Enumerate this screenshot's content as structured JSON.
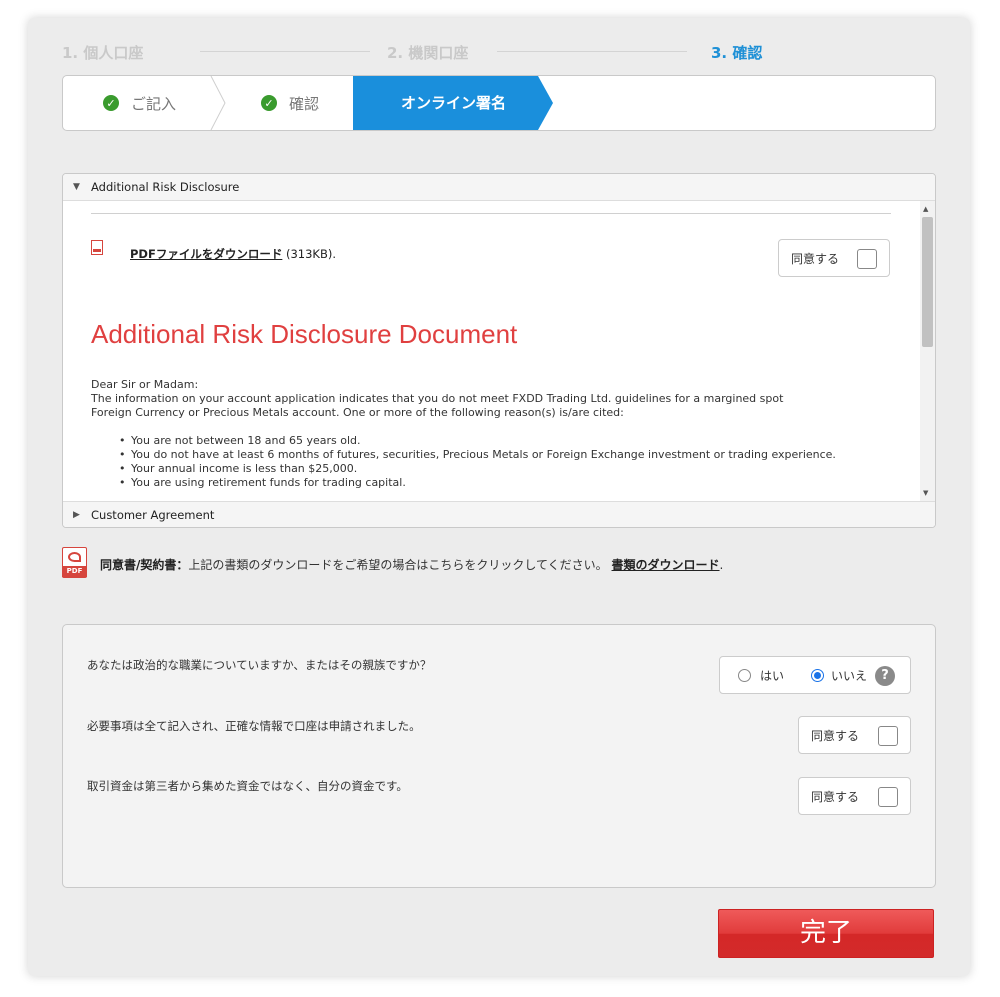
{
  "steps": {
    "step1": "1. 個人口座",
    "step2": "2. 機関口座",
    "step3": "3. 確認"
  },
  "substeps": {
    "fill": "ご記入",
    "confirm": "確認",
    "sign": "オンライン署名"
  },
  "accordion": {
    "section1_title": "Additional Risk Disclosure",
    "section2_title": "Customer Agreement",
    "download_link": "PDFファイルをダウンロード",
    "download_size": "(313KB).",
    "agree_label": "同意する",
    "doc_title": "Additional Risk Disclosure Document",
    "salutation": "Dear Sir or Madam:",
    "para1": "The information on your account application indicates that you do not meet FXDD Trading Ltd. guidelines for a margined spot",
    "para2": "Foreign Currency or Precious Metals account. One or more of the following reason(s) is/are cited:",
    "bullets": [
      "You are not between 18 and 65 years old.",
      "You do not have at least 6 months of futures, securities, Precious Metals or Foreign Exchange investment or trading experience.",
      "Your annual income is less than $25,000.",
      "You are using retirement funds for trading capital."
    ]
  },
  "download_all": {
    "label": "同意書/契約書：",
    "text": "上記の書類のダウンロードをご希望の場合はこちらをクリックしてください。",
    "link": "書類のダウンロード",
    "suffix": ".",
    "pdf_tag": "PDF"
  },
  "questions": {
    "q1": "あなたは政治的な職業についていますか、またはその親族ですか？",
    "yes": "はい",
    "no": "いいえ",
    "selected": "no",
    "help": "?",
    "q2": "必要事項は全て記入され、正確な情報で口座は申請されました。",
    "q3": "取引資金は第三者から集めた資金ではなく、自分の資金です。",
    "agree_label": "同意する"
  },
  "complete_button": "完了",
  "colors": {
    "accent": "#1a8fdc",
    "check": "#3a9b2e",
    "title_red": "#e04040",
    "button_red": "#d42828"
  }
}
